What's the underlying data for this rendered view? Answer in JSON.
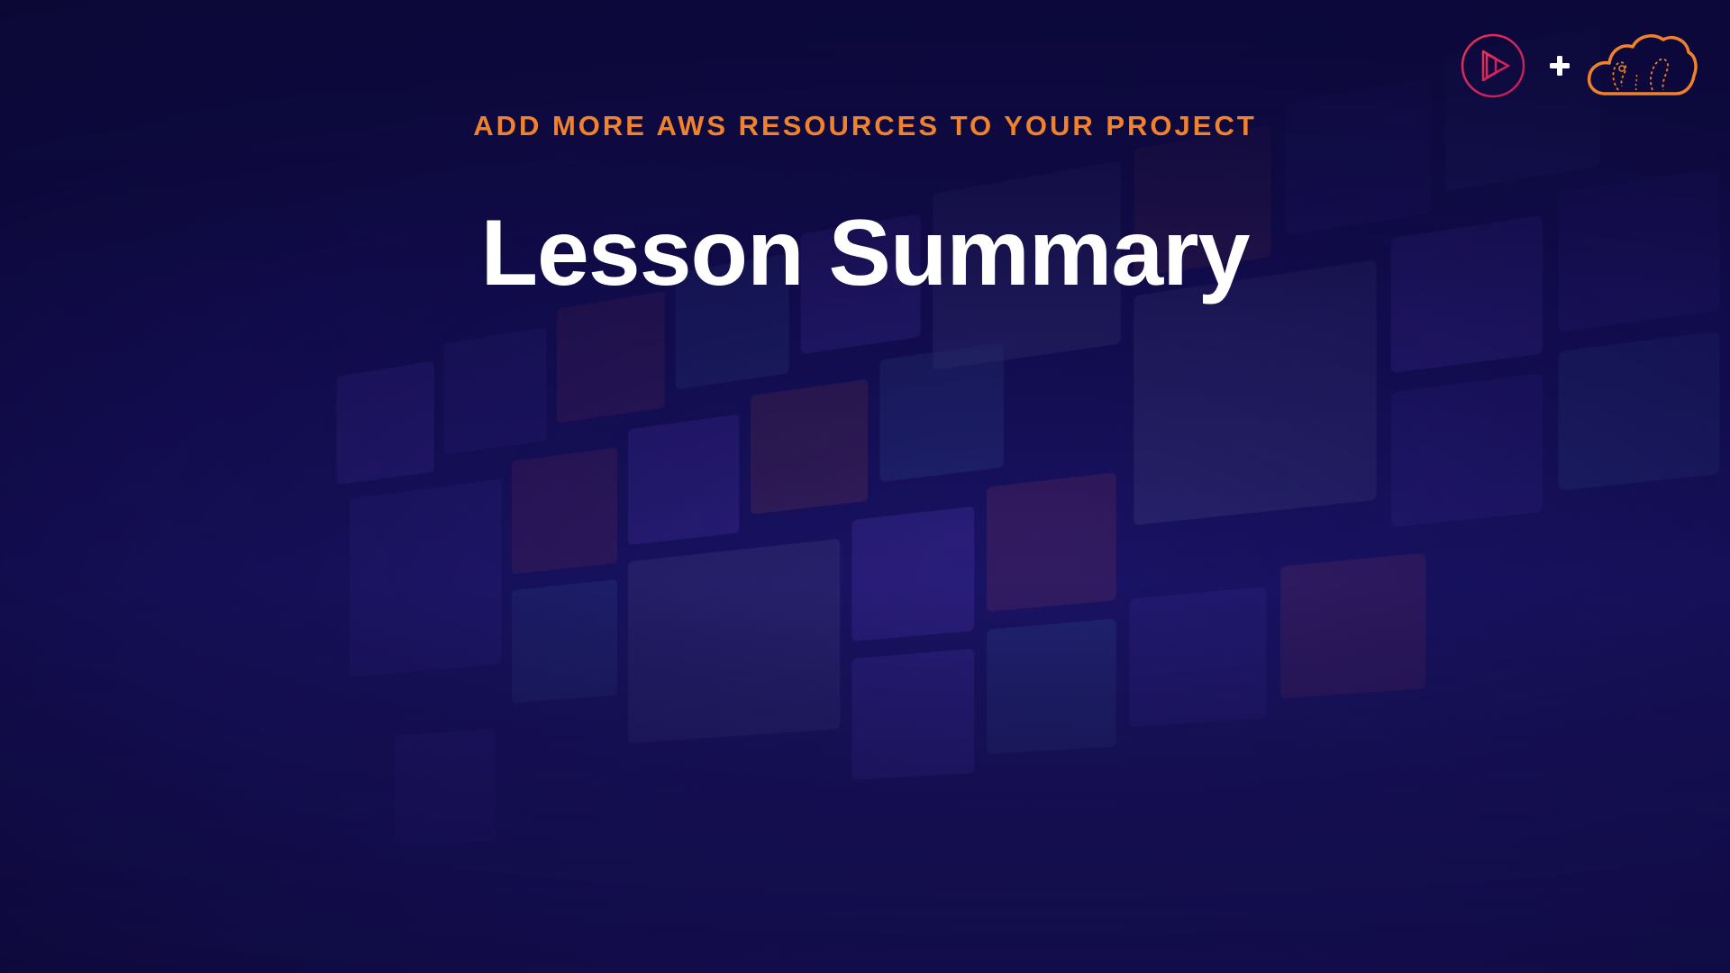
{
  "slide": {
    "eyebrow": "ADD MORE AWS RESOURCES TO YOUR PROJECT",
    "title": "Lesson Summary"
  },
  "logos": {
    "left": "play-icon",
    "separator": "plus-icon",
    "right": "cloud-icon"
  },
  "colors": {
    "background": "#140e55",
    "accent": "#f0822b",
    "title": "#ffffff",
    "play_logo_start": "#e8325a",
    "play_logo_end": "#c2195c"
  }
}
